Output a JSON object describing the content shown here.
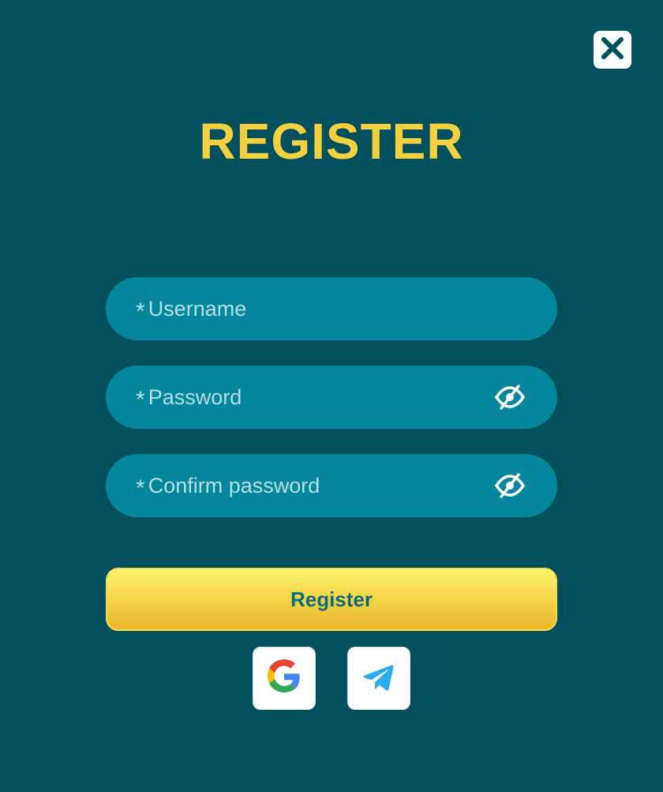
{
  "header": {
    "title": "REGISTER"
  },
  "form": {
    "username": {
      "placeholder": "Username",
      "value": "",
      "required_mark": "*"
    },
    "password": {
      "placeholder": "Password",
      "value": "",
      "required_mark": "*"
    },
    "confirm_password": {
      "placeholder": "Confirm password",
      "value": "",
      "required_mark": "*"
    },
    "submit_label": "Register"
  },
  "icons": {
    "close": "close-icon",
    "password_toggle": "eye-slash-icon",
    "google": "google-icon",
    "telegram": "telegram-icon"
  },
  "colors": {
    "background": "#024f5e",
    "field": "#04879c",
    "title": "#f6d13f",
    "button_top": "#fff36f",
    "button_bottom": "#eab52b",
    "button_text": "#0d6a7b",
    "placeholder": "#b8dfe6"
  }
}
